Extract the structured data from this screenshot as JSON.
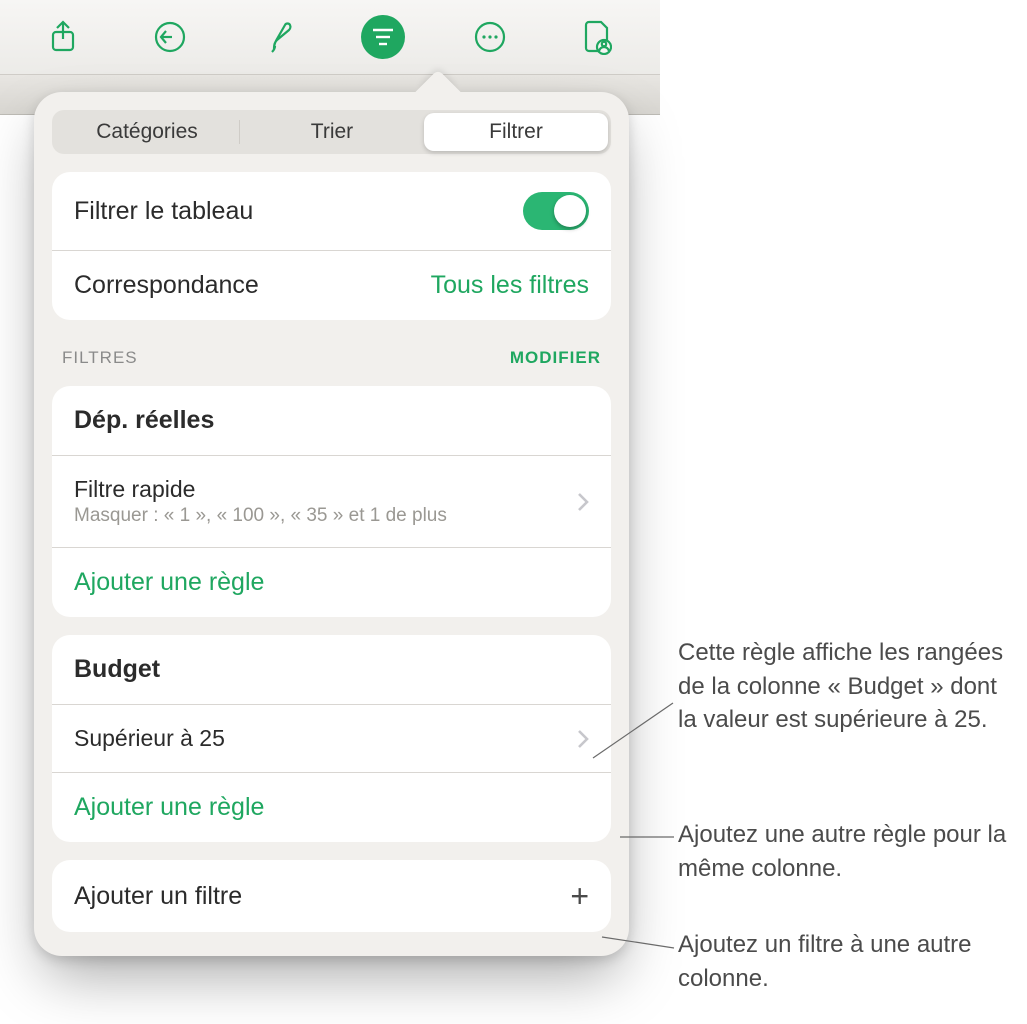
{
  "toolbar": {
    "icons": [
      "share",
      "undo",
      "format-brush",
      "organize",
      "more",
      "collaborate"
    ]
  },
  "popover": {
    "tabs": {
      "categories": "Catégories",
      "sort": "Trier",
      "filter": "Filtrer"
    },
    "filter_table_label": "Filtrer le tableau",
    "match_label": "Correspondance",
    "match_value": "Tous les filtres",
    "filters_section_label": "filtres",
    "modify_label": "modifier",
    "groups": [
      {
        "title": "Dép. réelles",
        "rule_title": "Filtre rapide",
        "rule_sub": "Masquer : « 1 », « 100 », « 35 » et 1 de plus",
        "add_rule": "Ajouter une règle"
      },
      {
        "title": "Budget",
        "rule_title": "Supérieur à 25",
        "add_rule": "Ajouter une règle"
      }
    ],
    "add_filter": "Ajouter un filtre"
  },
  "callouts": {
    "c1": "Cette règle affiche les rangées de la colonne « Budget » dont la valeur est supérieure à 25.",
    "c2": "Ajoutez une autre règle pour la même colonne.",
    "c3": "Ajoutez un filtre à une autre colonne."
  }
}
